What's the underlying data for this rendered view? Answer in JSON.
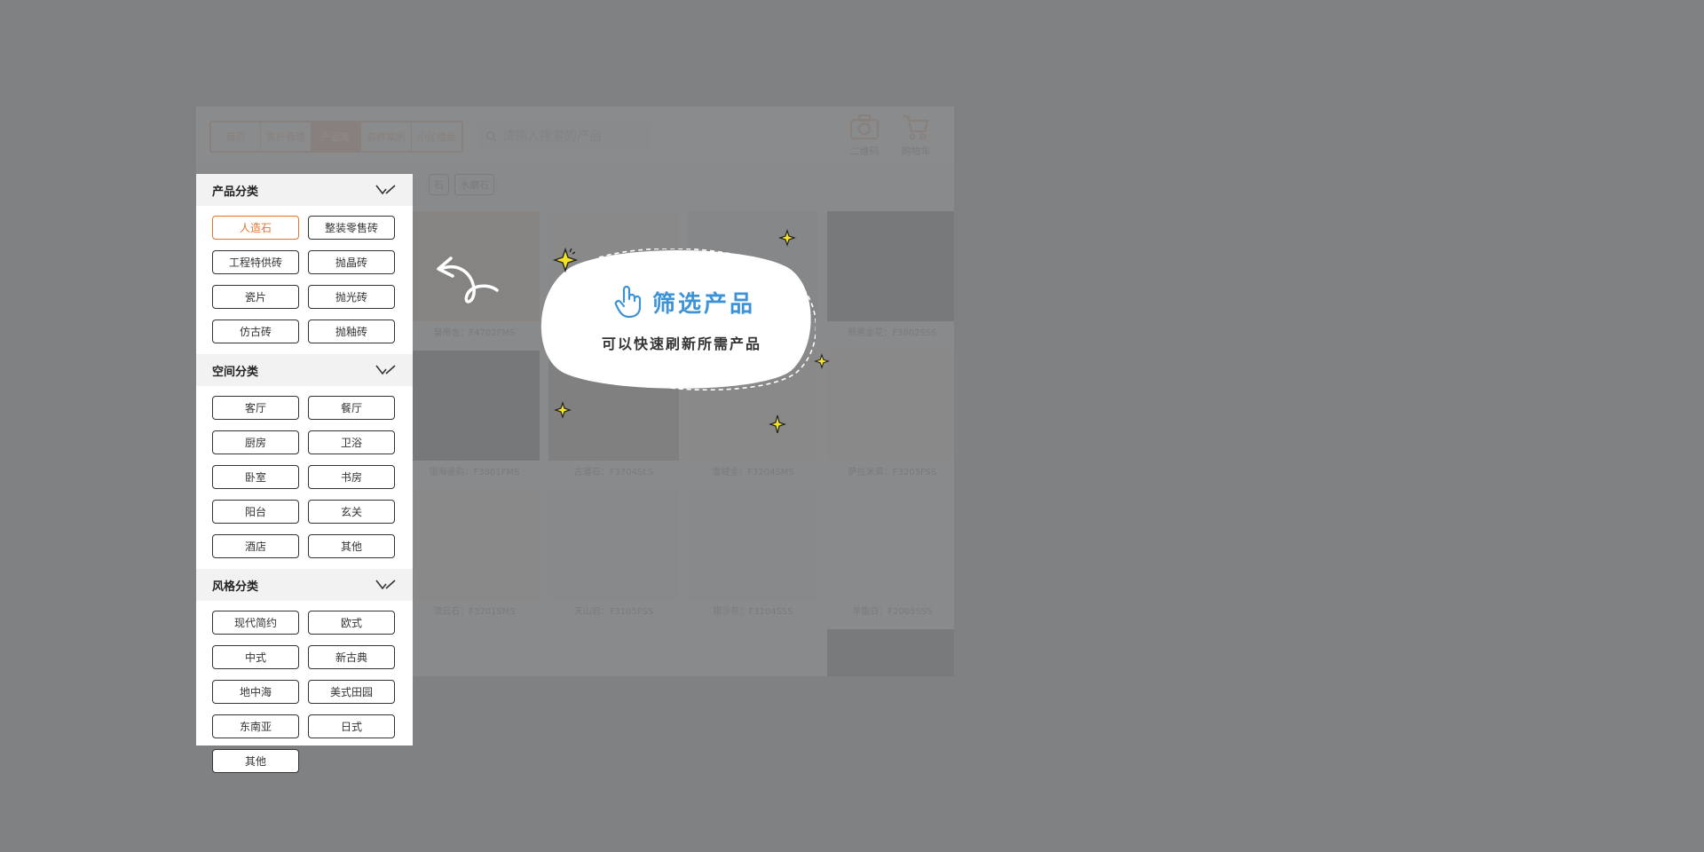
{
  "nav": {
    "tabs": [
      {
        "label": "首页",
        "active": false
      },
      {
        "label": "客户管理",
        "active": false
      },
      {
        "label": "产品库",
        "active": true
      },
      {
        "label": "装修案例",
        "active": false
      },
      {
        "label": "小区楼盘",
        "active": false
      }
    ]
  },
  "search": {
    "placeholder": "请输入搜索的产品",
    "icon": "search-icon"
  },
  "toolbar": {
    "qrcode_label": "二维码",
    "cart_label": "购物车"
  },
  "filter_chips": [
    "石",
    "水磨石"
  ],
  "sidebar": {
    "sections": [
      {
        "title": "产品分类",
        "items": [
          {
            "label": "人造石",
            "selected": true
          },
          {
            "label": "整装零售砖",
            "selected": false
          },
          {
            "label": "工程特供砖",
            "selected": false
          },
          {
            "label": "抛晶砖",
            "selected": false
          },
          {
            "label": "瓷片",
            "selected": false
          },
          {
            "label": "抛光砖",
            "selected": false
          },
          {
            "label": "仿古砖",
            "selected": false
          },
          {
            "label": "抛釉砖",
            "selected": false
          }
        ]
      },
      {
        "title": "空间分类",
        "items": [
          {
            "label": "客厅",
            "selected": false
          },
          {
            "label": "餐厅",
            "selected": false
          },
          {
            "label": "厨房",
            "selected": false
          },
          {
            "label": "卫浴",
            "selected": false
          },
          {
            "label": "卧室",
            "selected": false
          },
          {
            "label": "书房",
            "selected": false
          },
          {
            "label": "阳台",
            "selected": false
          },
          {
            "label": "玄关",
            "selected": false
          },
          {
            "label": "酒店",
            "selected": false
          },
          {
            "label": "其他",
            "selected": false
          }
        ]
      },
      {
        "title": "风格分类",
        "items": [
          {
            "label": "现代简约",
            "selected": false
          },
          {
            "label": "欧式",
            "selected": false
          },
          {
            "label": "中式",
            "selected": false
          },
          {
            "label": "新古典",
            "selected": false
          },
          {
            "label": "地中海",
            "selected": false
          },
          {
            "label": "美式田园",
            "selected": false
          },
          {
            "label": "东南亚",
            "selected": false
          },
          {
            "label": "日式",
            "selected": false
          },
          {
            "label": "其他",
            "selected": false
          }
        ]
      }
    ]
  },
  "products": [
    {
      "name": "皇帝金：F4702FMS",
      "color": "#c9a878"
    },
    {
      "name": "",
      "color": "#efe6d6"
    },
    {
      "name": "",
      "color": "#cfc9c0"
    },
    {
      "name": "新黑金花：F3802SSS",
      "color": "#1e1a17"
    },
    {
      "name": "银海墨韵：F3801FMS",
      "color": "#151515"
    },
    {
      "name": "古道石：F3704SLS",
      "color": "#8a7157"
    },
    {
      "name": "雪绒金：F3204SMS",
      "color": "#e9e3d2"
    },
    {
      "name": "萨拉米黄：F3203FSS",
      "color": "#ece3cf"
    },
    {
      "name": "流云石：F3201SMS",
      "color": "#ece7da"
    },
    {
      "name": "天山岩：F3105FSS",
      "color": "#e6e4e0"
    },
    {
      "name": "银沙灰：F3104SSS",
      "color": "#e2dfda"
    },
    {
      "name": "羊脂白：F2005SSS",
      "color": "#eeedea"
    },
    {
      "name": "",
      "color": "#efefef"
    },
    {
      "name": "",
      "color": "#f0efec"
    },
    {
      "name": "",
      "color": "#e8e8e8"
    },
    {
      "name": "",
      "color": "#2a2723"
    }
  ],
  "tooltip": {
    "title": "筛选产品",
    "subtitle": "可以快速刷新所需产品"
  },
  "colors": {
    "accent": "#e5742a",
    "tooltip_title": "#3d93d8",
    "overlay": "#808183"
  }
}
